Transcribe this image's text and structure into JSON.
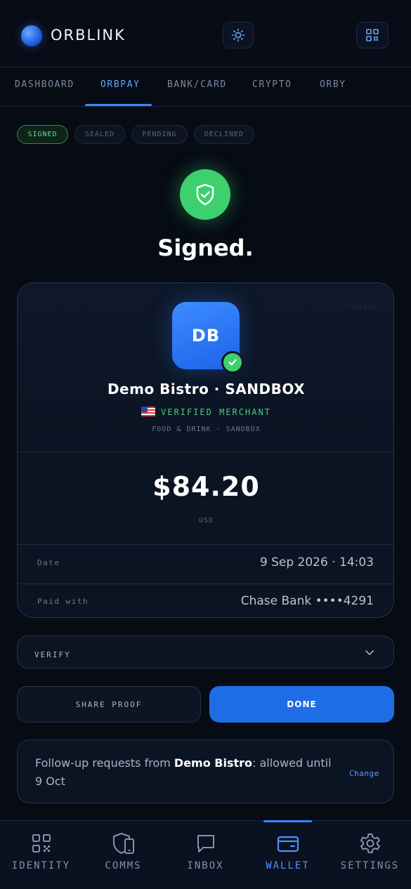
{
  "app": {
    "name": "ORBLINK"
  },
  "tabs": [
    {
      "label": "DASHBOARD"
    },
    {
      "label": "ORBPAY"
    },
    {
      "label": "BANK/CARD"
    },
    {
      "label": "CRYPTO"
    },
    {
      "label": "ORBY"
    }
  ],
  "active_tab": "ORBPAY",
  "status_chips": [
    {
      "label": "SIGNED",
      "active": true
    },
    {
      "label": "SEALED",
      "active": false
    },
    {
      "label": "PENDING",
      "active": false
    },
    {
      "label": "DECLINED",
      "active": false
    }
  ],
  "status_title": "Signed.",
  "receipt": {
    "watermark": "SANDBOX",
    "merchant_initials": "DB",
    "merchant_name": "Demo Bistro · SANDBOX",
    "verified_label": "VERIFIED MERCHANT",
    "category": "FOOD & DRINK · SANDBOX",
    "amount": "$84.20",
    "currency": "USD",
    "rows": [
      {
        "label": "Date",
        "value": "9 Sep 2026 · 14:03"
      },
      {
        "label": "Paid with",
        "value": "Chase Bank ••••4291"
      }
    ]
  },
  "verify": {
    "label": "VERIFY"
  },
  "actions": {
    "share": "SHARE PROOF",
    "done": "DONE"
  },
  "follow_up": {
    "prefix": "Follow-up requests from ",
    "merchant": "Demo Bistro",
    "suffix": ": allowed until 9 Oct",
    "change": "Change"
  },
  "bottom_nav": [
    {
      "label": "IDENTITY",
      "icon": "qr-grid-icon"
    },
    {
      "label": "COMMS",
      "icon": "shield-phone-icon"
    },
    {
      "label": "INBOX",
      "icon": "chat-bubble-icon"
    },
    {
      "label": "WALLET",
      "icon": "wallet-icon"
    },
    {
      "label": "SETTINGS",
      "icon": "gear-icon"
    }
  ],
  "active_nav": "WALLET",
  "colors": {
    "accent": "#3a86ff",
    "success": "#3ed06f",
    "background": "#060b14"
  }
}
